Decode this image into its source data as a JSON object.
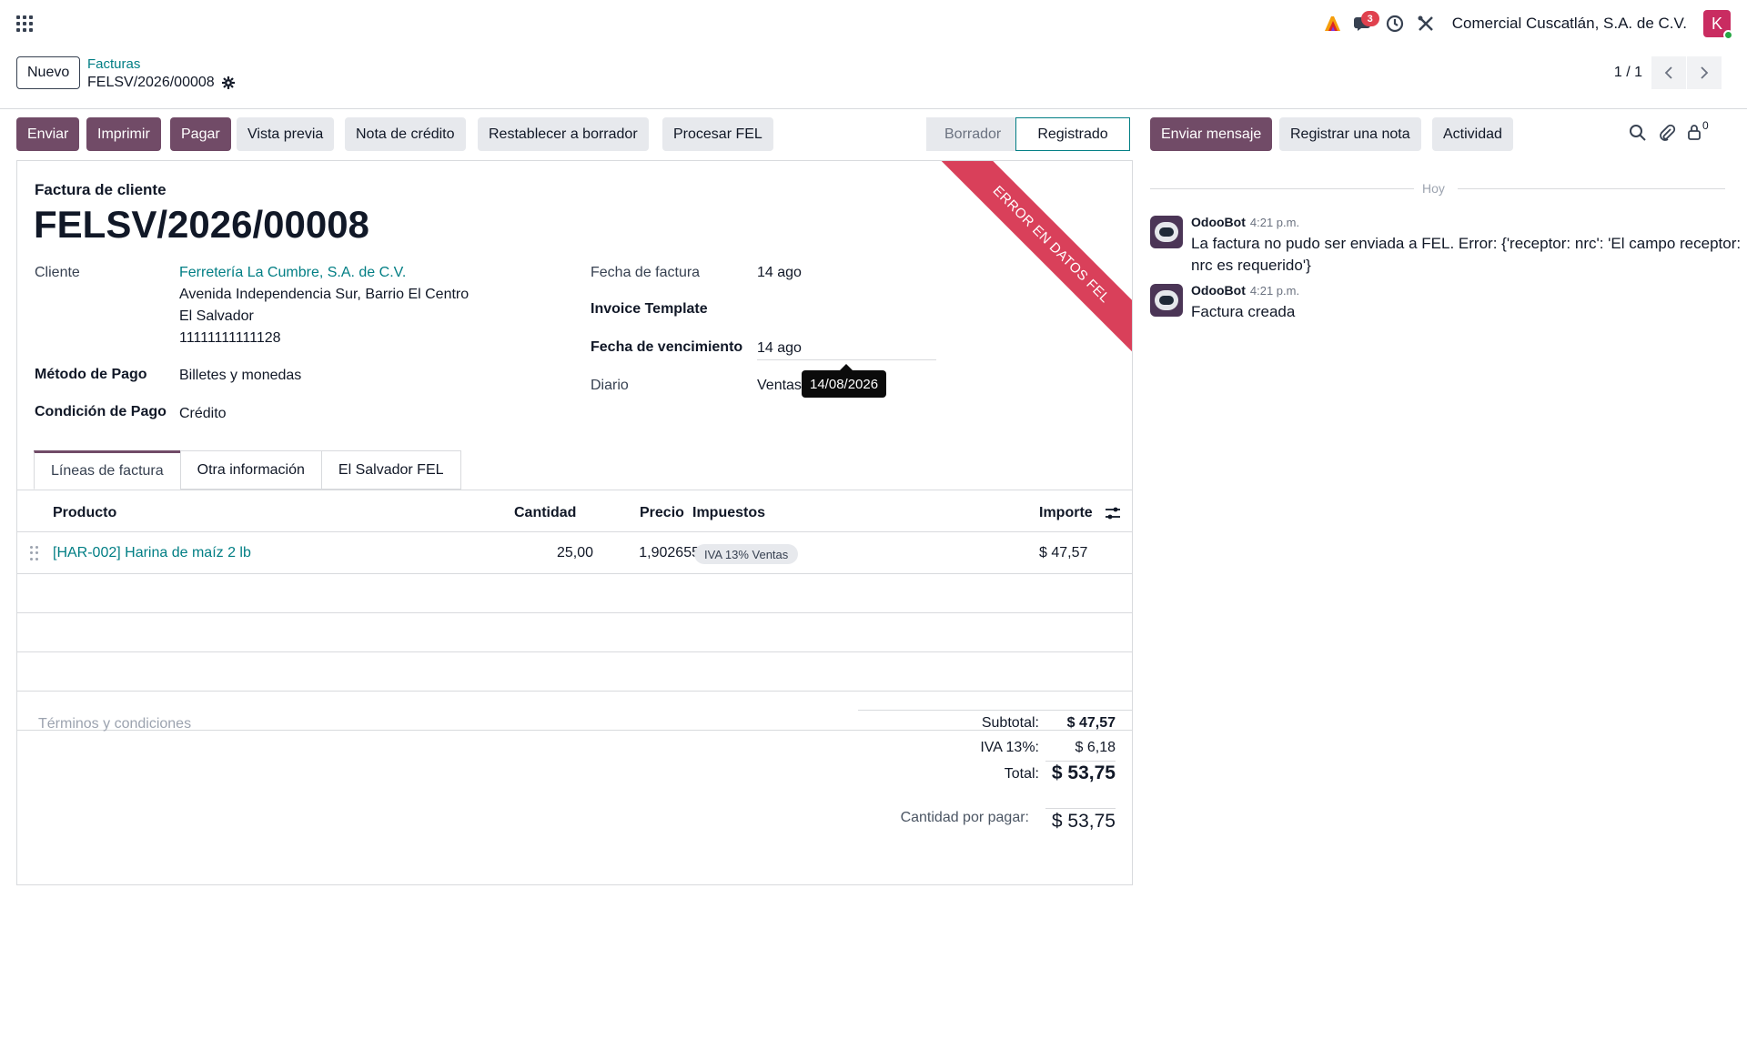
{
  "navbar": {
    "company": "Comercial Cuscatlán, S.A. de C.V.",
    "messages_badge": "3",
    "user_initial": "K"
  },
  "control": {
    "new_button": "Nuevo",
    "breadcrumb_parent": "Facturas",
    "record": "FELSV/2026/00008",
    "pager": "1 / 1"
  },
  "buttons": {
    "send": "Enviar",
    "print": "Imprimir",
    "pay": "Pagar",
    "preview": "Vista previa",
    "credit_note": "Nota de crédito",
    "reset_draft": "Restablecer a borrador",
    "process_fel": "Procesar FEL"
  },
  "status": {
    "draft": "Borrador",
    "posted": "Registrado"
  },
  "form": {
    "ribbon": "ERROR EN DATOS FEL",
    "doc_type": "Factura de cliente",
    "title": "FELSV/2026/00008",
    "customer_label": "Cliente",
    "customer_name": "Ferretería La Cumbre, S.A. de C.V.",
    "customer_address_1": "Avenida Independencia Sur, Barrio El Centro",
    "customer_address_2": "El Salvador",
    "customer_id": "11111111111128",
    "payment_method_label": "Método de Pago",
    "payment_method": "Billetes y monedas",
    "payment_condition_label": "Condición de Pago",
    "payment_condition": "Crédito",
    "invoice_date_label": "Fecha de factura",
    "invoice_date": "14 ago",
    "template_label": "Invoice Template",
    "due_date_label": "Fecha de vencimiento",
    "due_date": "14 ago",
    "journal_label": "Diario",
    "journal": "Ventas",
    "tooltip": "14/08/2026"
  },
  "tabs": [
    {
      "label": "Líneas de factura"
    },
    {
      "label": "Otra información"
    },
    {
      "label": "El Salvador FEL"
    }
  ],
  "lines": {
    "headers": {
      "product": "Producto",
      "quantity": "Cantidad",
      "price": "Precio",
      "taxes": "Impuestos",
      "amount": "Importe"
    },
    "rows": [
      {
        "product": "[HAR-002] Harina de maíz 2 lb",
        "quantity": "25,00",
        "price": "1,902655",
        "tax": "IVA 13% Ventas",
        "amount": "$ 47,57"
      }
    ]
  },
  "totals": {
    "terms_placeholder": "Términos y condiciones",
    "subtotal_label": "Subtotal:",
    "subtotal": "$ 47,57",
    "iva_label": "IVA 13%:",
    "iva": "$ 6,18",
    "total_label": "Total:",
    "total": "$ 53,75",
    "due_label": "Cantidad por pagar:",
    "due": "$ 53,75"
  },
  "chatter": {
    "send_message": "Enviar mensaje",
    "log_note": "Registrar una nota",
    "activity": "Actividad",
    "followers_count": "0",
    "today": "Hoy",
    "messages": [
      {
        "author": "OdooBot",
        "time": "4:21 p.m.",
        "body_1": "La factura no pudo ser enviada a FEL. Error: {'receptor: nrc': 'El campo receptor:",
        "body_2": "nrc es requerido'}"
      },
      {
        "author": "OdooBot",
        "time": "4:21 p.m.",
        "body_1": "Factura creada"
      }
    ]
  },
  "colors": {
    "primary": "#714b67",
    "link": "#017e84",
    "ribbon": "#d9405a",
    "avatar": "#c92c61"
  }
}
